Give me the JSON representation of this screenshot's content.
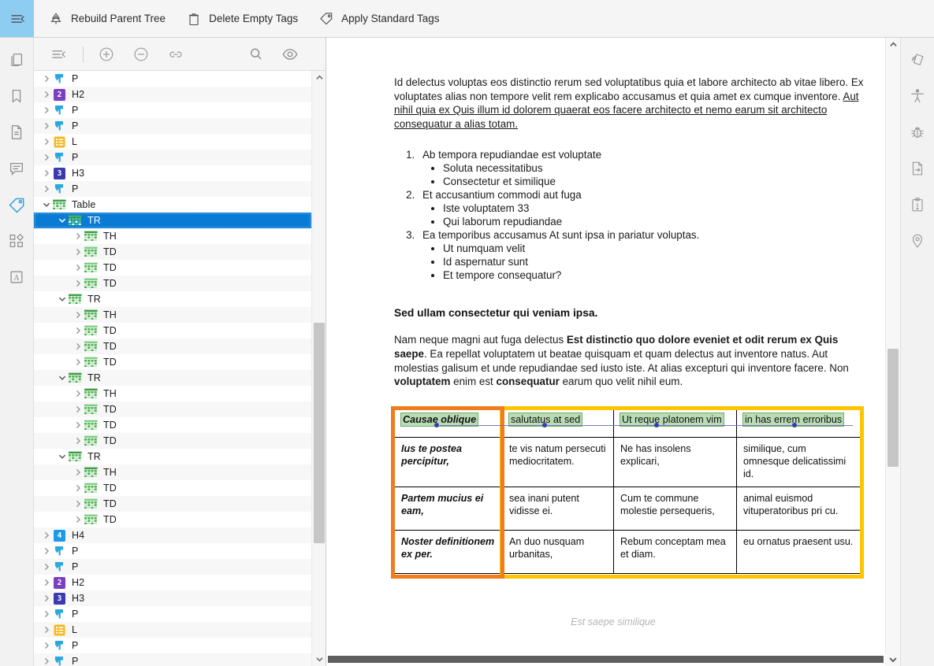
{
  "topbar": {
    "toggle_icon": "collapse-panel-icon",
    "items": [
      {
        "icon": "tree-refresh-icon",
        "label": "Rebuild Parent Tree"
      },
      {
        "icon": "trash-icon",
        "label": "Delete Empty Tags"
      },
      {
        "icon": "tag-icon",
        "label": "Apply Standard Tags"
      }
    ]
  },
  "left_rail": {
    "items": [
      {
        "name": "pages-icon",
        "active": false
      },
      {
        "name": "bookmark-icon",
        "active": false
      },
      {
        "name": "document-icon",
        "active": false
      },
      {
        "name": "comment-icon",
        "active": false
      },
      {
        "name": "tag-icon",
        "active": true
      },
      {
        "name": "layers-icon",
        "active": false
      },
      {
        "name": "accessibility-text-icon",
        "active": false
      }
    ]
  },
  "right_rail": {
    "items": [
      {
        "name": "organize-pages-icon"
      },
      {
        "name": "accessibility-person-icon"
      },
      {
        "name": "preflight-bug-icon"
      },
      {
        "name": "export-file-icon"
      },
      {
        "name": "report-alert-icon"
      },
      {
        "name": "location-pin-icon"
      }
    ]
  },
  "tag_toolbar": {
    "items": [
      {
        "name": "collapse-all-icon"
      },
      {
        "name": "separator"
      },
      {
        "name": "add-tag-icon"
      },
      {
        "name": "remove-tag-icon"
      },
      {
        "name": "link-icon"
      },
      {
        "name": "spacer"
      },
      {
        "name": "search-icon"
      },
      {
        "name": "highlight-visibility-icon"
      }
    ]
  },
  "tree": {
    "nodes": [
      {
        "label": "P",
        "type": "P",
        "depth": 0,
        "twisty": "collapsed"
      },
      {
        "label": "H2",
        "type": "H2",
        "depth": 0,
        "twisty": "collapsed"
      },
      {
        "label": "P",
        "type": "P",
        "depth": 0,
        "twisty": "collapsed"
      },
      {
        "label": "P",
        "type": "P",
        "depth": 0,
        "twisty": "collapsed"
      },
      {
        "label": "L",
        "type": "L",
        "depth": 0,
        "twisty": "collapsed"
      },
      {
        "label": "P",
        "type": "P",
        "depth": 0,
        "twisty": "collapsed"
      },
      {
        "label": "H3",
        "type": "H3",
        "depth": 0,
        "twisty": "collapsed"
      },
      {
        "label": "P",
        "type": "P",
        "depth": 0,
        "twisty": "collapsed"
      },
      {
        "label": "Table",
        "type": "Table",
        "depth": 0,
        "twisty": "expanded"
      },
      {
        "label": "TR",
        "type": "TR",
        "depth": 1,
        "twisty": "expanded",
        "selected": true
      },
      {
        "label": "TH",
        "type": "TH",
        "depth": 2,
        "twisty": "collapsed"
      },
      {
        "label": "TD",
        "type": "TD",
        "depth": 2,
        "twisty": "collapsed"
      },
      {
        "label": "TD",
        "type": "TD",
        "depth": 2,
        "twisty": "collapsed"
      },
      {
        "label": "TD",
        "type": "TD",
        "depth": 2,
        "twisty": "collapsed"
      },
      {
        "label": "TR",
        "type": "TR",
        "depth": 1,
        "twisty": "expanded"
      },
      {
        "label": "TH",
        "type": "TH",
        "depth": 2,
        "twisty": "collapsed"
      },
      {
        "label": "TD",
        "type": "TD",
        "depth": 2,
        "twisty": "collapsed"
      },
      {
        "label": "TD",
        "type": "TD",
        "depth": 2,
        "twisty": "collapsed"
      },
      {
        "label": "TD",
        "type": "TD",
        "depth": 2,
        "twisty": "collapsed"
      },
      {
        "label": "TR",
        "type": "TR",
        "depth": 1,
        "twisty": "expanded"
      },
      {
        "label": "TH",
        "type": "TH",
        "depth": 2,
        "twisty": "collapsed"
      },
      {
        "label": "TD",
        "type": "TD",
        "depth": 2,
        "twisty": "collapsed"
      },
      {
        "label": "TD",
        "type": "TD",
        "depth": 2,
        "twisty": "collapsed"
      },
      {
        "label": "TD",
        "type": "TD",
        "depth": 2,
        "twisty": "collapsed"
      },
      {
        "label": "TR",
        "type": "TR",
        "depth": 1,
        "twisty": "expanded"
      },
      {
        "label": "TH",
        "type": "TH",
        "depth": 2,
        "twisty": "collapsed"
      },
      {
        "label": "TD",
        "type": "TD",
        "depth": 2,
        "twisty": "collapsed"
      },
      {
        "label": "TD",
        "type": "TD",
        "depth": 2,
        "twisty": "collapsed"
      },
      {
        "label": "TD",
        "type": "TD",
        "depth": 2,
        "twisty": "collapsed"
      },
      {
        "label": "H4",
        "type": "H4",
        "depth": 0,
        "twisty": "collapsed"
      },
      {
        "label": "P",
        "type": "P",
        "depth": 0,
        "twisty": "collapsed"
      },
      {
        "label": "P",
        "type": "P",
        "depth": 0,
        "twisty": "collapsed"
      },
      {
        "label": "H2",
        "type": "H2",
        "depth": 0,
        "twisty": "collapsed"
      },
      {
        "label": "H3",
        "type": "H3",
        "depth": 0,
        "twisty": "collapsed"
      },
      {
        "label": "P",
        "type": "P",
        "depth": 0,
        "twisty": "collapsed"
      },
      {
        "label": "L",
        "type": "L",
        "depth": 0,
        "twisty": "collapsed"
      },
      {
        "label": "P",
        "type": "P",
        "depth": 0,
        "twisty": "collapsed"
      },
      {
        "label": "P",
        "type": "P",
        "depth": 0,
        "twisty": "collapsed"
      }
    ],
    "badge_colors": {
      "H2": "#7b3fbf",
      "H3": "#3b3bb0",
      "H4": "#1a9ae8",
      "L": "#f5b820",
      "P": "#29a8e0",
      "Table": "#43b649",
      "TR": "#43b649",
      "TH": "#43b649",
      "TD": "#43b649"
    }
  },
  "document": {
    "paragraph_1": {
      "plain_a": "Id delectus voluptas eos distinctio rerum sed voluptatibus quia et labore architecto ab vitae libero. Ex voluptates alias non tempore velit rem explicabo accusamus et quia amet ex cumque inventore. ",
      "underlined": "Aut nihil quia ex Quis illum id dolorem quaerat eos facere architecto et nemo earum sit architecto consequatur a alias totam."
    },
    "list": [
      {
        "number": "1.",
        "text": "Ab tempora repudiandae est voluptate",
        "children": [
          "Soluta necessitatibus",
          "Consectetur et similique"
        ]
      },
      {
        "number": "2.",
        "text": "Et accusantium commodi aut fuga",
        "children": [
          "Iste voluptatem 33",
          "Qui laborum repudiandae"
        ]
      },
      {
        "number": "3.",
        "text": "Ea temporibus accusamus At sunt ipsa in pariatur voluptas.",
        "children": [
          "Ut numquam velit",
          "Id aspernatur sunt",
          "Et tempore consequatur?"
        ]
      }
    ],
    "heading": "Sed ullam consectetur qui veniam ipsa.",
    "paragraph_2": {
      "a": "Nam neque magni aut fuga delectus ",
      "bold_1": "Est distinctio quo dolore eveniet et odit rerum ex Quis saepe",
      "b": ". Ea repellat voluptatem ut beatae quisquam et quam delectus aut inventore natus. Aut molestias galisum et unde repudiandae sed iusto iste. At alias excepturi qui inventore facere. Non ",
      "bold_2": "voluptatem",
      "c": " enim est ",
      "bold_3": "consequatur",
      "d": " earum quo velit nihil eum."
    },
    "table": {
      "header": [
        "Causae oblique",
        "salutatus at sed",
        "Ut reque platonem vim",
        "in has errem erroribus"
      ],
      "rows": [
        {
          "head": "Ius te postea percipitur,",
          "cells": [
            "te vis natum persecuti mediocritatem.",
            "Ne has insolens explicari,",
            "similique, cum omnesque delicatissimi id."
          ]
        },
        {
          "head": "Partem mucius ei eam,",
          "cells": [
            "sea inani putent vidisse ei.",
            "Cum te commune molestie persequeris,",
            "animal euismod vituperatoribus pri cu."
          ]
        },
        {
          "head": "Noster definitionem ex per.",
          "cells": [
            "An duo nusquam urbanitas,",
            "Rebum conceptam mea et diam.",
            "eu ornatus praesent usu."
          ]
        }
      ]
    },
    "footnote": "Est saepe similique"
  },
  "colors": {
    "selection_orange": "#f07c1e",
    "selection_yellow": "#fdc500",
    "tag_highlight_green": "#b9dcb4",
    "tree_selected_blue": "#0a7bd4",
    "rail_active_blue": "#2a9fe0",
    "toolbar_toggle_blue": "#8ecdf2"
  }
}
